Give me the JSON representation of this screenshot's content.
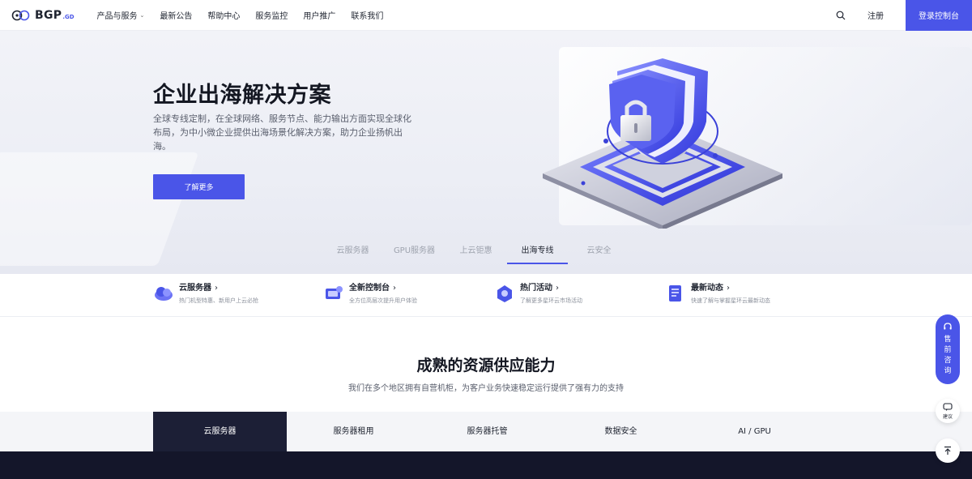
{
  "header": {
    "logo_text": "BGP",
    "logo_sub": ".GD",
    "nav": [
      {
        "label": "产品与服务",
        "has_caret": true
      },
      {
        "label": "最新公告"
      },
      {
        "label": "帮助中心"
      },
      {
        "label": "服务监控"
      },
      {
        "label": "用户推广"
      },
      {
        "label": "联系我们"
      }
    ],
    "register_label": "注册",
    "login_label": "登录控制台"
  },
  "hero": {
    "title": "企业出海解决方案",
    "description": "全球专线定制，在全球网络、服务节点、能力输出方面实现全球化布局，为中小微企业提供出海场景化解决方案，助力企业扬帆出海。",
    "button_label": "了解更多",
    "tabs": [
      "云服务器",
      "GPU服务器",
      "上云钜惠",
      "出海专线",
      "云安全"
    ],
    "active_tab": 3
  },
  "features": [
    {
      "title": "云服务器",
      "subtitle": "热门机型特惠、新用户上云必抢"
    },
    {
      "title": "全新控制台",
      "subtitle": "全方位高层次提升用户体验"
    },
    {
      "title": "热门活动",
      "subtitle": "了解更多星环云市场活动"
    },
    {
      "title": "最新动态",
      "subtitle": "快速了解与掌握星环云最新动态"
    }
  ],
  "section": {
    "title": "成熟的资源供应能力",
    "subtitle": "我们在多个地区拥有自营机柜，为客户业务快速稳定运行提供了强有力的支持",
    "tabs": [
      "云服务器",
      "服务器租用",
      "服务器托管",
      "数据安全",
      "AI / GPU"
    ],
    "active_tab": 0
  },
  "floating": {
    "consult_label": "售前咨询",
    "feedback_label": "建议",
    "top_icon": "arrow-up-icon"
  },
  "colors": {
    "accent": "#4a55e8",
    "dark": "#1c1f36"
  }
}
